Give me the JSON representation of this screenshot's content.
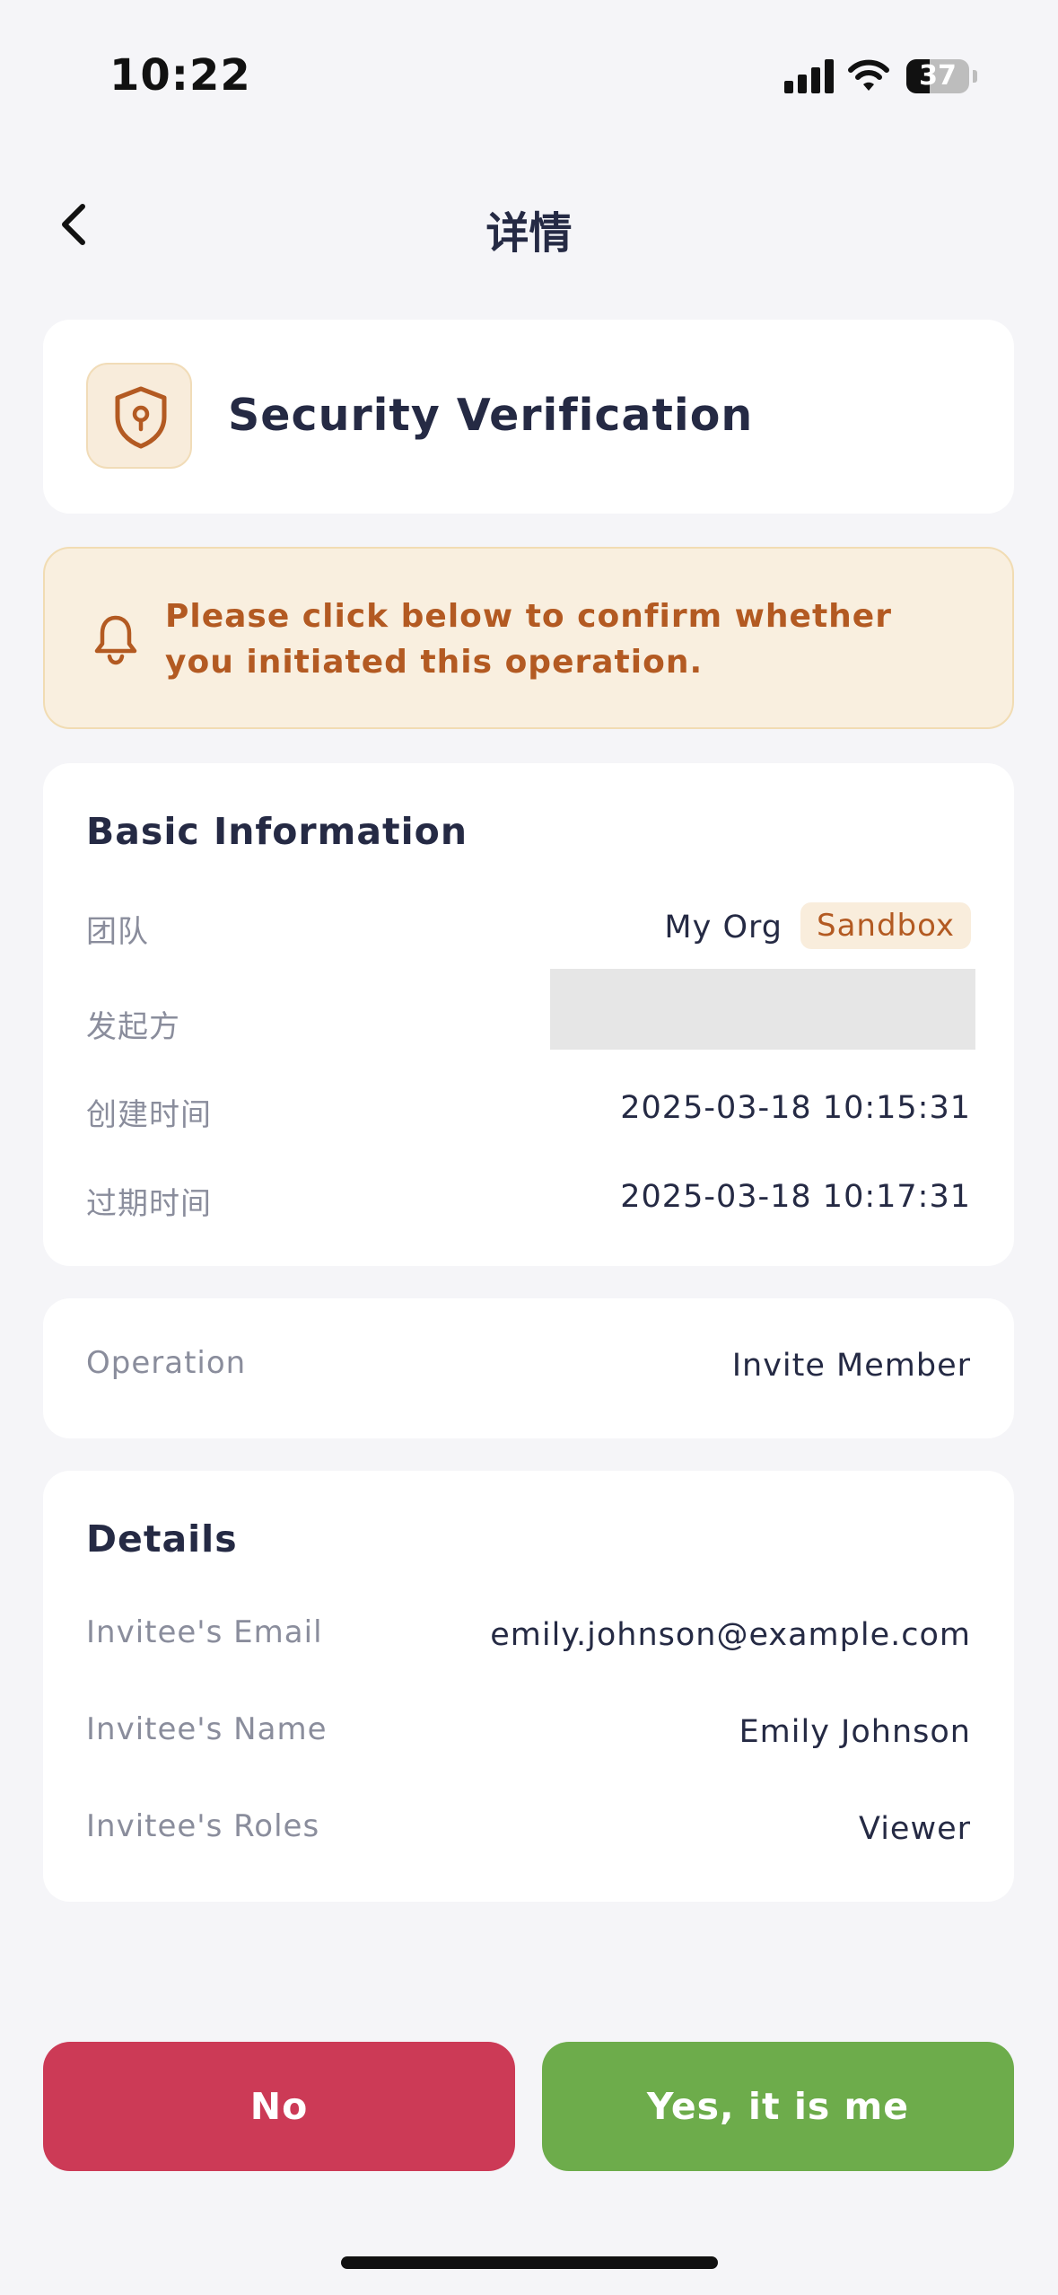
{
  "status_bar": {
    "time": "10:22",
    "battery": "37"
  },
  "header": {
    "title": "详情"
  },
  "security_card": {
    "title": "Security Verification"
  },
  "notice": {
    "text": "Please click below to confirm whether you initiated this operation."
  },
  "basic_info": {
    "title": "Basic Information",
    "team_label": "团队",
    "team_value": "My Org",
    "team_badge": "Sandbox",
    "initiator_label": "发起方",
    "created_label": "创建时间",
    "created_value": "2025-03-18 10:15:31",
    "expires_label": "过期时间",
    "expires_value": "2025-03-18 10:17:31"
  },
  "operation": {
    "label": "Operation",
    "value": "Invite Member"
  },
  "details": {
    "title": "Details",
    "email_label": "Invitee's Email",
    "email_value": "emily.johnson@example.com",
    "name_label": "Invitee's Name",
    "name_value": "Emily Johnson",
    "roles_label": "Invitee's Roles",
    "roles_value": "Viewer"
  },
  "actions": {
    "no_label": "No",
    "yes_label": "Yes, it is me"
  },
  "colors": {
    "accent_orange": "#b35a22",
    "no_button": "#cc3a56",
    "yes_button": "#6dac4b",
    "page_background": "#f5f5f8"
  },
  "icons": [
    "back-chevron-icon",
    "shield-lock-icon",
    "bell-icon",
    "signal-icon",
    "wifi-icon",
    "battery-icon"
  ]
}
